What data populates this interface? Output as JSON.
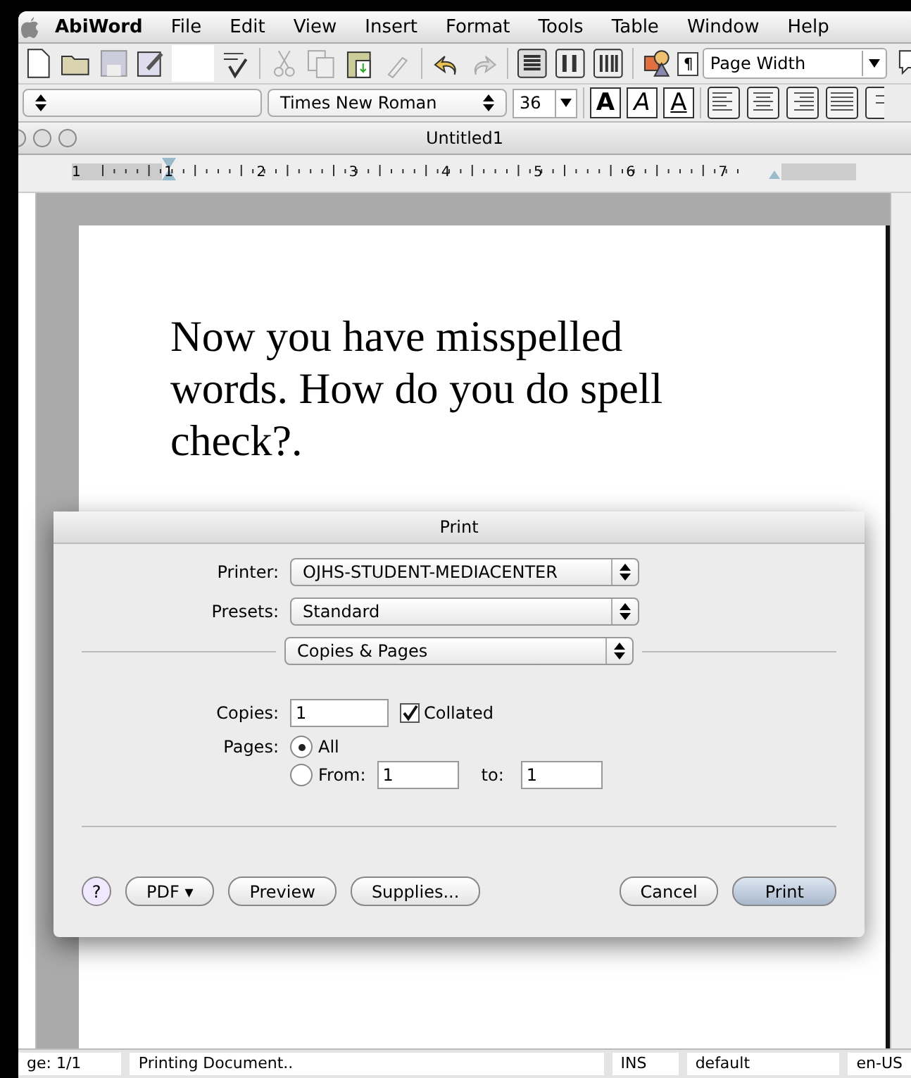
{
  "menu_bar": {
    "app": "AbiWord",
    "items": [
      "File",
      "Edit",
      "View",
      "Insert",
      "Format",
      "Tools",
      "Table",
      "Window",
      "Help"
    ]
  },
  "toolbar": {
    "pilcrow": "¶",
    "zoom": "Page Width"
  },
  "format_bar": {
    "font": "Times New Roman",
    "size": "36",
    "styles": [
      {
        "label": "A",
        "kind": "bold"
      },
      {
        "label": "A",
        "kind": "italic"
      },
      {
        "label": "A",
        "kind": "underline"
      }
    ]
  },
  "document": {
    "title": "Untitled1",
    "ruler_labels": [
      "1",
      "1",
      "2",
      "3",
      "4",
      "5",
      "6",
      "7"
    ],
    "text": "Now you have misspelled words. How do you do spell check?."
  },
  "print_dialog": {
    "title": "Print",
    "printer_label": "Printer:",
    "printer": "OJHS-STUDENT-MEDIACENTER",
    "presets_label": "Presets:",
    "presets": "Standard",
    "panel": "Copies & Pages",
    "copies_label": "Copies:",
    "copies": "1",
    "collated": {
      "label": "Collated",
      "checked": true
    },
    "pages_label": "Pages:",
    "pages_options": [
      {
        "label": "All",
        "selected": true
      },
      {
        "label": "From:",
        "selected": false
      }
    ],
    "from": "1",
    "to_label": "to:",
    "to": "1",
    "buttons": [
      {
        "label": "?",
        "kind": "help"
      },
      {
        "label": "PDF ▾",
        "kind": "normal"
      },
      {
        "label": "Preview",
        "kind": "normal"
      },
      {
        "label": "Supplies...",
        "kind": "normal"
      },
      {
        "label": "Cancel",
        "kind": "normal"
      },
      {
        "label": "Print",
        "kind": "default"
      }
    ]
  },
  "status_bar": [
    "ge: 1/1",
    "Printing Document..",
    "INS",
    "default",
    "en-US"
  ]
}
